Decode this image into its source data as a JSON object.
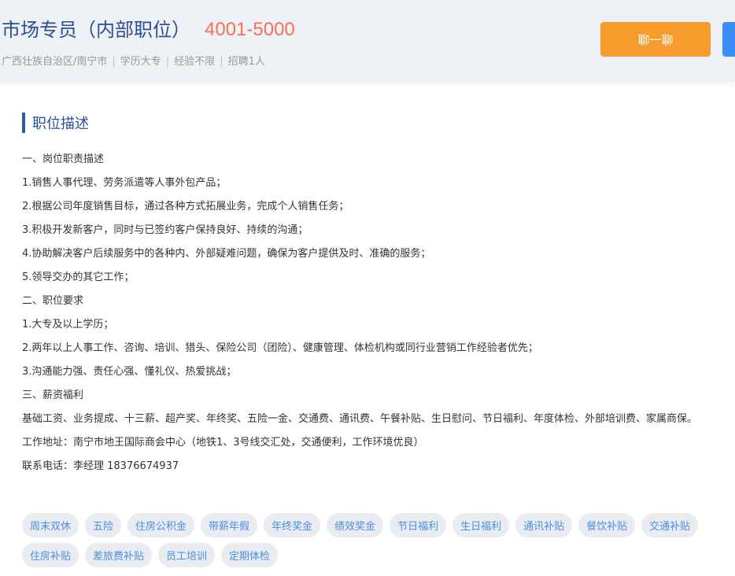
{
  "job": {
    "title": "市场专员（内部职位）",
    "salary": "4001-5000",
    "location": "广西壮族自治区/南宁市",
    "education": "学历大专",
    "experience": "经验不限",
    "headcount": "招聘1人",
    "separator": "|"
  },
  "actions": {
    "chat_label": "聊一聊"
  },
  "description": {
    "section_title": "职位描述",
    "lines": [
      "一、岗位职责描述",
      "1.销售人事代理、劳务派遣等人事外包产品；",
      "2.根据公司年度销售目标，通过各种方式拓展业务，完成个人销售任务；",
      "3.积极开发新客户，同时与已签约客户保持良好、持续的沟通；",
      "4.协助解决客户后续服务中的各种内、外部疑难问题，确保为客户提供及时、准确的服务；",
      "5.领导交办的其它工作；",
      "二、职位要求",
      "1.大专及以上学历；",
      "2.两年以上人事工作、咨询、培训、猎头、保险公司（团险）、健康管理、体检机构或同行业营销工作经验者优先；",
      "3.沟通能力强、责任心强、懂礼仪、热爱挑战；",
      "三、薪资福利"
    ],
    "benefits_paragraph": "基础工资、业务提成、十三薪、超产奖、年终奖、五险一金、交通费、通讯费、午餐补贴、生日慰问、节日福利、年度体检、外部培训费、家属商保。",
    "address": "工作地址：南宁市地王国际商会中心（地铁1、3号线交汇处，交通便利，工作环境优良）",
    "contact": "联系电话：李经理 18376674937"
  },
  "tags": [
    "周末双休",
    "五险",
    "住房公积金",
    "带薪年假",
    "年终奖金",
    "绩效奖金",
    "节日福利",
    "生日福利",
    "通讯补贴",
    "餐饮补贴",
    "交通补贴",
    "住房补贴",
    "差旅费补贴",
    "员工培训",
    "定期体检"
  ],
  "colors": {
    "title": "#2b4f94",
    "salary": "#f4715a",
    "chat_button": "#f79b2c",
    "second_button": "#3b8ef3",
    "tag_text": "#4a8fe0",
    "tag_bg": "#e9ecf1"
  }
}
